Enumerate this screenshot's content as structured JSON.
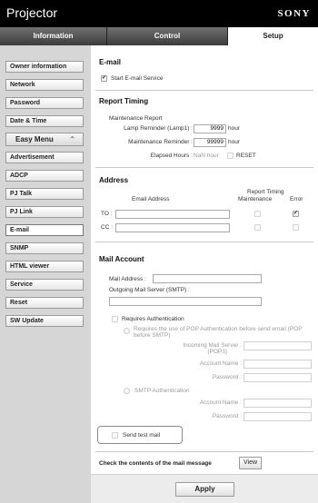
{
  "app": {
    "title": "Projector",
    "brand": "SONY"
  },
  "tabs": [
    {
      "label": "Information"
    },
    {
      "label": "Control"
    },
    {
      "label": "Setup"
    }
  ],
  "sidebar": {
    "items": [
      {
        "label": "Owner information"
      },
      {
        "label": "Network"
      },
      {
        "label": "Password"
      },
      {
        "label": "Date & Time"
      },
      {
        "label": "Easy Menu",
        "icon": "chevron-double-up-icon"
      },
      {
        "label": "Advertisement"
      },
      {
        "label": "ADCP"
      },
      {
        "label": "PJ Talk"
      },
      {
        "label": "PJ Link"
      },
      {
        "label": "E-mail",
        "active": true
      },
      {
        "label": "SNMP"
      },
      {
        "label": "HTML viewer"
      },
      {
        "label": "Service"
      },
      {
        "label": "Reset"
      },
      {
        "label": "SW Update"
      }
    ]
  },
  "email": {
    "title": "E-mail",
    "start_service": {
      "label": "Start E-mail Service",
      "checked": true
    }
  },
  "report_timing": {
    "title": "Report Timing",
    "maintenance_report": "Maintenance Report",
    "lamp_reminder": {
      "label": "Lamp Reminder (Lamp1) :",
      "value": "9999",
      "unit": "hour"
    },
    "maintenance_reminder": {
      "label": "Maintenance Reminder :",
      "value": "99999",
      "unit": "hour"
    },
    "elapsed": {
      "label": "Elapsed Hours :",
      "value": "NaN hour",
      "reset_label": "RESET"
    }
  },
  "address": {
    "title": "Address",
    "email_address_header": "Email Address",
    "report_timing_header": "Report Timing",
    "maintenance_header": "Maintenance",
    "error_header": "Error",
    "rows": [
      {
        "label": "TO :",
        "value": "",
        "maintenance": false,
        "error": true
      },
      {
        "label": "CC :",
        "value": "",
        "maintenance": false,
        "error": false
      }
    ]
  },
  "mail_account": {
    "title": "Mail Account",
    "mail_address_label": "Mail Address :",
    "mail_address_value": "",
    "smtp_label": "Outgoing Mail Server (SMTP) :",
    "smtp_value": "",
    "requires_auth": {
      "label": "Requires Authentication",
      "checked": false
    },
    "pop_option": {
      "label": "Requires the use of POP Authentication before send email (POP before SMTP)",
      "server_label_1": "Incoming Mail Server :",
      "server_label_2": "(POP3)",
      "account_label": "Account Name :",
      "password_label": "Password :"
    },
    "smtp_option": {
      "label": "SMTP Authentication",
      "account_label": "Account Name :",
      "password_label": "Password :"
    },
    "send_test": {
      "label": "Send test mail",
      "checked": false
    }
  },
  "check_contents": {
    "label": "Check the contents of the mail message",
    "button": "View"
  },
  "apply_button": "Apply",
  "colors": {
    "header_bg": "#000000",
    "sidebar_bg": "#d6d6d6",
    "accent": "#ffffff"
  }
}
